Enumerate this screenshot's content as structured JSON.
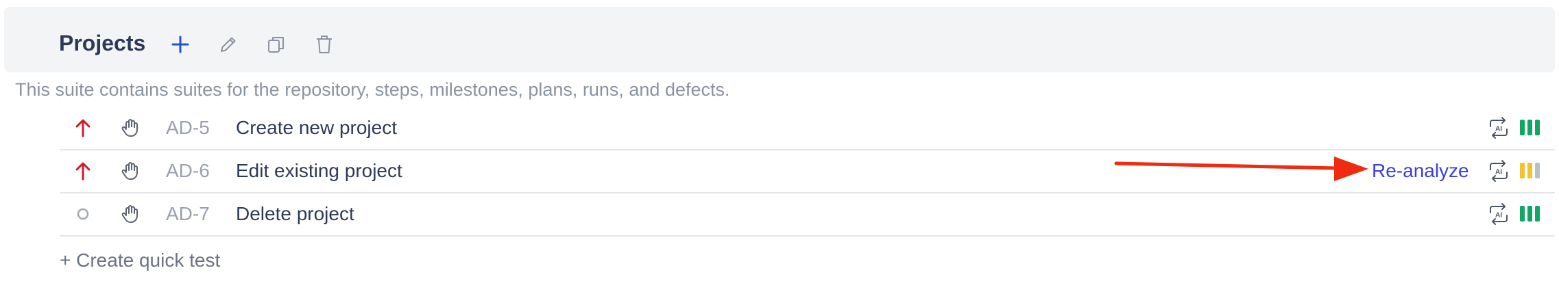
{
  "header": {
    "title": "Projects"
  },
  "description": "This suite contains suites for the repository, steps, milestones, plans, runs, and defects.",
  "tests": [
    {
      "priority": "high",
      "code": "AD-5",
      "name": "Create new project",
      "action": "",
      "health": [
        "green",
        "green",
        "green"
      ]
    },
    {
      "priority": "high",
      "code": "AD-6",
      "name": "Edit existing project",
      "action": "Re-analyze",
      "health": [
        "yellow",
        "yellow",
        "gray"
      ]
    },
    {
      "priority": "none",
      "code": "AD-7",
      "name": "Delete project",
      "action": "",
      "health": [
        "green",
        "green",
        "green"
      ]
    }
  ],
  "footer": {
    "create_quick_test": "+ Create quick test"
  },
  "colors": {
    "priority_high": "#d0182c",
    "health_green": "#10a765",
    "health_yellow": "#f2c230",
    "health_gray": "#b9bec7",
    "annotation_arrow": "#ef2b12",
    "link": "#3b3fd9"
  },
  "icons": {
    "add": "plus-icon",
    "edit": "pencil-icon",
    "copy": "copy-icon",
    "delete": "trash-icon",
    "manual": "hand-icon",
    "ai": "ai-refresh-icon"
  }
}
